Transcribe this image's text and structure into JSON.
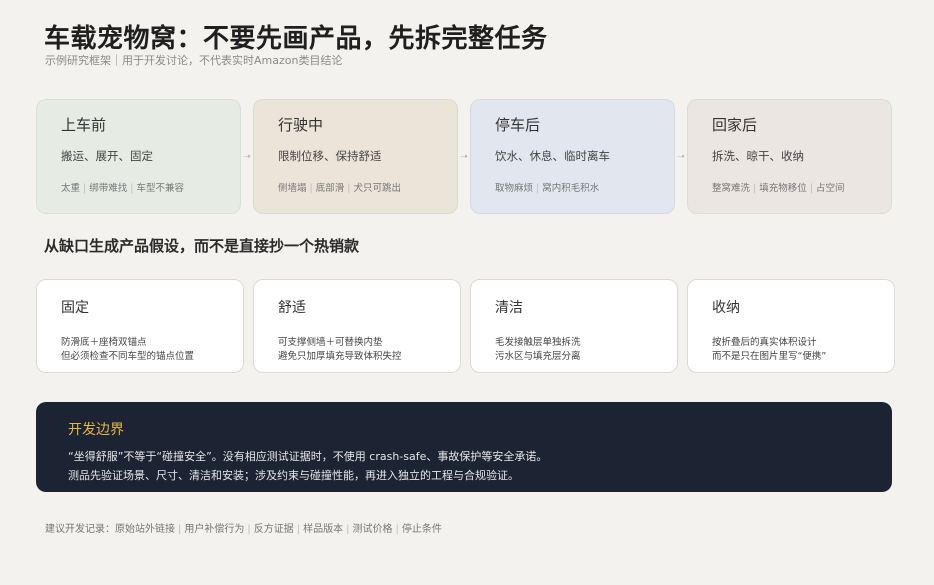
{
  "header": {
    "title": "车载宠物窝：不要先画产品，先拆完整任务",
    "subtitle": "示例研究框架｜用于开发讨论，不代表实时Amazon类目结论"
  },
  "stages": [
    {
      "title": "上车前",
      "desc": "搬运、展开、固定",
      "pains": [
        "太重",
        "绑带难找",
        "车型不兼容"
      ],
      "bg": "#e6ebe4"
    },
    {
      "title": "行驶中",
      "desc": "限制位移、保持舒适",
      "pains": [
        "侧墙塌",
        "底部滑",
        "犬只可跳出"
      ],
      "bg": "#ebe4d8"
    },
    {
      "title": "停车后",
      "desc": "饮水、休息、临时离车",
      "pains": [
        "取物麻烦",
        "窝内积毛积水"
      ],
      "bg": "#e1e6ef"
    },
    {
      "title": "回家后",
      "desc": "拆洗、晾干、收纳",
      "pains": [
        "整窝难洗",
        "填充物移位",
        "占空间"
      ],
      "bg": "#ece6e3"
    }
  ],
  "section": {
    "title": "从缺口生成产品假设，而不是直接抄一个热销款"
  },
  "dimensions": [
    {
      "title": "固定",
      "lines": [
        "防滑底＋座椅双锚点",
        "但必须检查不同车型的锚点位置"
      ]
    },
    {
      "title": "舒适",
      "lines": [
        "可支撑侧墙＋可替换内垫",
        "避免只加厚填充导致体积失控"
      ]
    },
    {
      "title": "清洁",
      "lines": [
        "毛发接触层单独拆洗",
        "污水区与填充层分离"
      ]
    },
    {
      "title": "收纳",
      "lines": [
        "按折叠后的真实体积设计",
        "而不是只在图片里写“便携”"
      ]
    }
  ],
  "boundary": {
    "title": "开发边界",
    "lines": [
      "“坐得舒服”不等于“碰撞安全”。没有相应测试证据时，不使用 crash-safe、事故保护等安全承诺。",
      "测品先验证场景、尺寸、清洁和安装；涉及约束与碰撞性能，再进入独立的工程与合规验证。"
    ]
  },
  "footer": {
    "label": "建议开发记录：",
    "items": [
      "原始站外链接",
      "用户补偿行为",
      "反方证据",
      "样品版本",
      "测试价格",
      "停止条件"
    ]
  },
  "icons": {
    "stage_arrow": "arrow-right-icon"
  }
}
